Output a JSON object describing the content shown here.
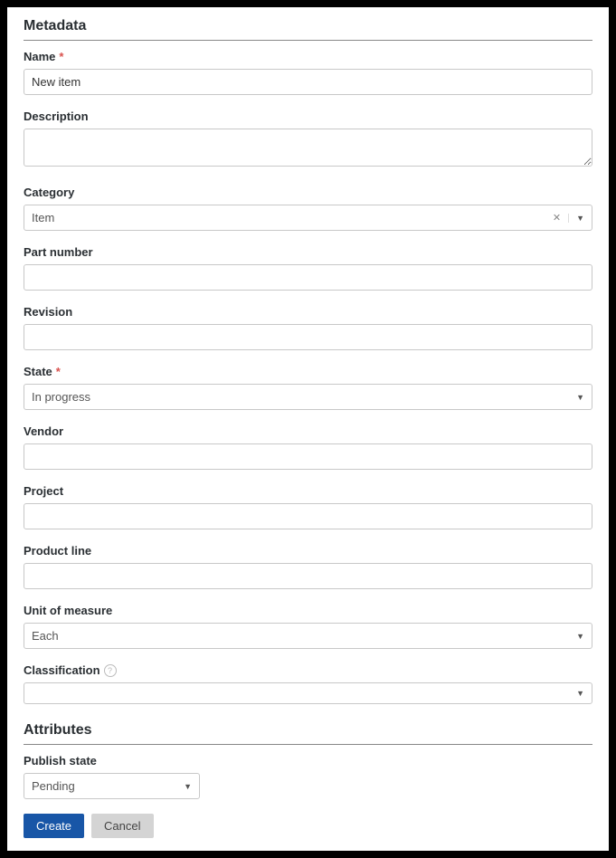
{
  "sections": {
    "metadata_header": "Metadata",
    "attributes_header": "Attributes"
  },
  "fields": {
    "name": {
      "label": "Name",
      "required": true,
      "value": "New item"
    },
    "description": {
      "label": "Description",
      "value": ""
    },
    "category": {
      "label": "Category",
      "value": "Item"
    },
    "part_number": {
      "label": "Part number",
      "value": ""
    },
    "revision": {
      "label": "Revision",
      "value": ""
    },
    "state": {
      "label": "State",
      "required": true,
      "value": "In progress"
    },
    "vendor": {
      "label": "Vendor",
      "value": ""
    },
    "project": {
      "label": "Project",
      "value": ""
    },
    "product_line": {
      "label": "Product line",
      "value": ""
    },
    "unit_of_measure": {
      "label": "Unit of measure",
      "value": "Each"
    },
    "classification": {
      "label": "Classification",
      "value": ""
    },
    "publish_state": {
      "label": "Publish state",
      "value": "Pending"
    }
  },
  "required_marker": "*",
  "help_marker": "?",
  "buttons": {
    "create": "Create",
    "cancel": "Cancel"
  }
}
